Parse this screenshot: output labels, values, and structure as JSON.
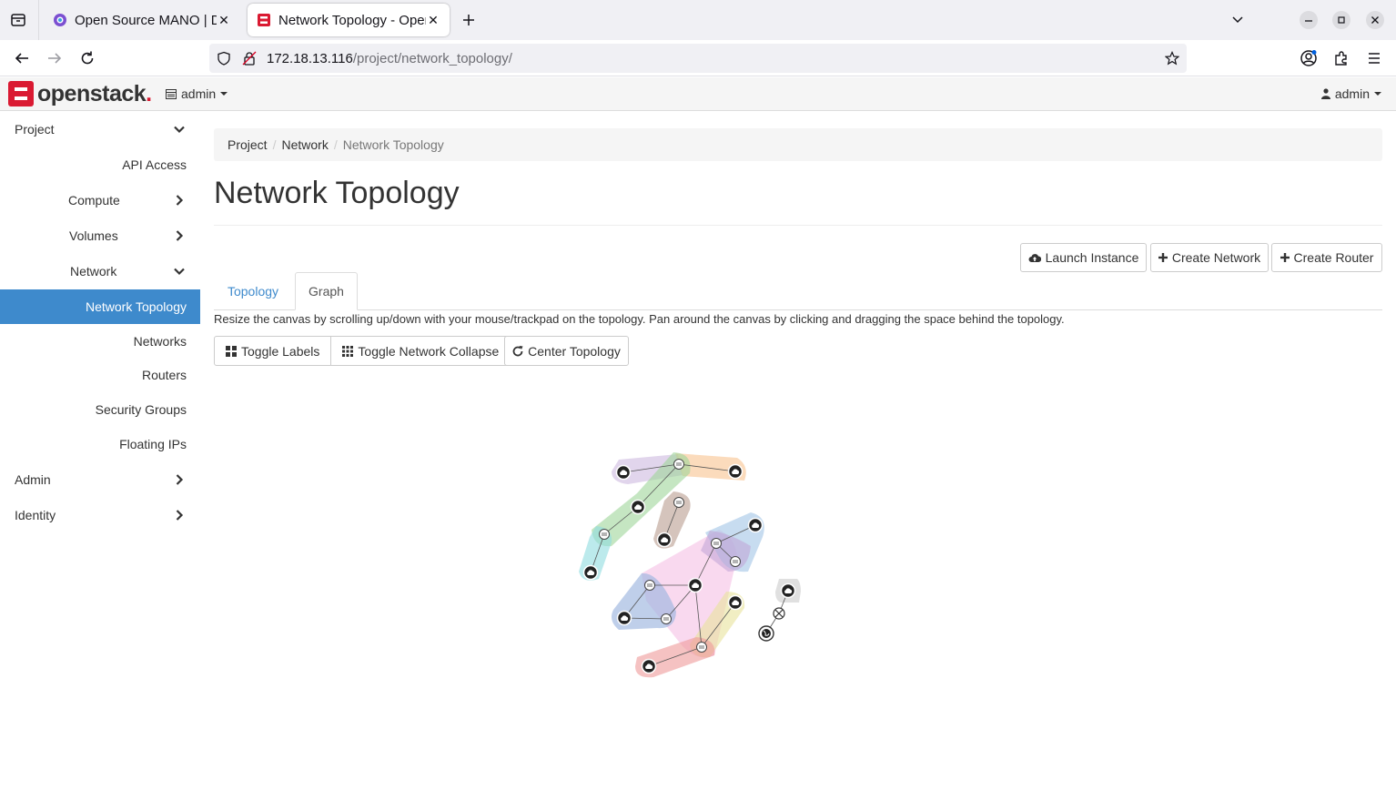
{
  "browser": {
    "tabs": [
      {
        "title": "Open Source MANO | Das",
        "active": false
      },
      {
        "title": "Network Topology - Oper",
        "active": true
      }
    ],
    "url_host": "172.18.13.116",
    "url_path": "/project/network_topology/"
  },
  "header": {
    "brand": "openstack",
    "brand_dot": ".",
    "project_menu": "admin",
    "user_menu": "admin"
  },
  "sidebar": {
    "items": [
      {
        "label": "Project",
        "chevron": "down"
      },
      {
        "label": "API Access"
      },
      {
        "label": "Compute",
        "chevron": "right"
      },
      {
        "label": "Volumes",
        "chevron": "right"
      },
      {
        "label": "Network",
        "chevron": "down"
      },
      {
        "label": "Network Topology",
        "active": true
      },
      {
        "label": "Networks"
      },
      {
        "label": "Routers"
      },
      {
        "label": "Security Groups"
      },
      {
        "label": "Floating IPs"
      },
      {
        "label": "Admin",
        "chevron": "right"
      },
      {
        "label": "Identity",
        "chevron": "right"
      }
    ]
  },
  "breadcrumb": [
    "Project",
    "Network",
    "Network Topology"
  ],
  "page_title": "Network Topology",
  "actions": {
    "launch_instance": "Launch Instance",
    "create_network": "Create Network",
    "create_router": "Create Router"
  },
  "tabs": {
    "topology": "Topology",
    "graph": "Graph"
  },
  "help_text": "Resize the canvas by scrolling up/down with your mouse/trackpad on the topology. Pan around the canvas by clicking and dragging the space behind the topology.",
  "graph_buttons": {
    "toggle_labels": "Toggle Labels",
    "toggle_network_collapse": "Toggle Network Collapse",
    "center_topology": "Center Topology"
  },
  "colors": {
    "accent": "#3e8acc",
    "brand_red": "#da1a32"
  }
}
